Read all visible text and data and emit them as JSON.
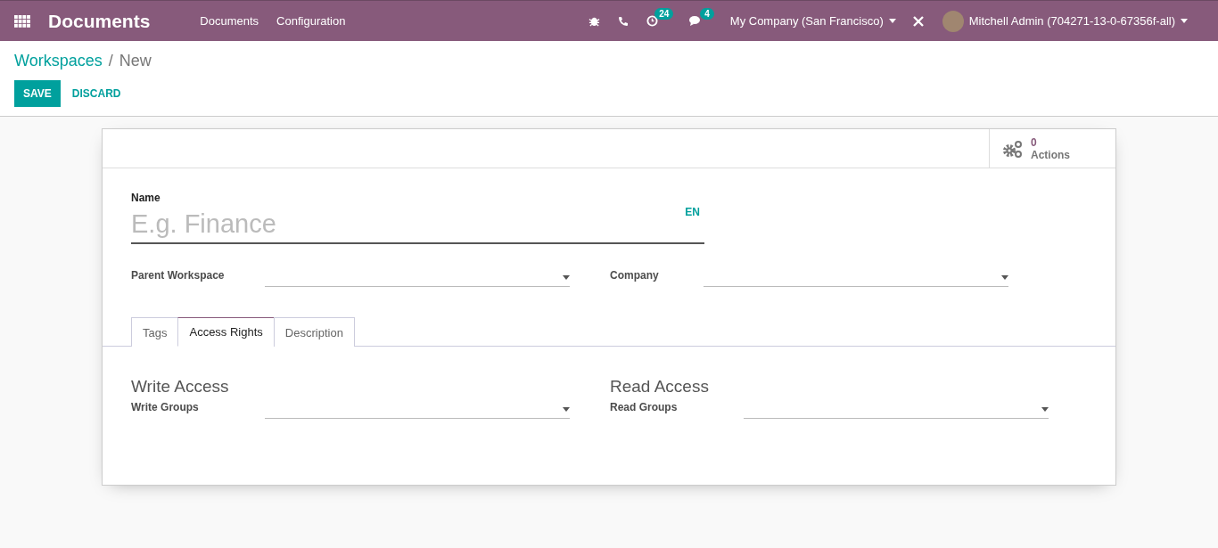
{
  "navbar": {
    "app_title": "Documents",
    "menus": [
      "Documents",
      "Configuration"
    ],
    "activity_count": "24",
    "messages_count": "4",
    "company": "My Company (San Francisco)",
    "user": "Mitchell Admin (704271-13-0-67356f-all)"
  },
  "breadcrumb": [
    "Workspaces",
    "New"
  ],
  "breadcrumb_separator": "/",
  "buttons": {
    "save": "SAVE",
    "discard": "DISCARD"
  },
  "button_box": {
    "count": "0",
    "label": "Actions"
  },
  "name_field": {
    "label": "Name",
    "placeholder": "E.g. Finance",
    "lang": "EN"
  },
  "fields": [
    {
      "label": "Parent Workspace"
    },
    {
      "label": "Company"
    }
  ],
  "tabs": [
    {
      "label": "Tags",
      "selected": false
    },
    {
      "label": "Access Rights",
      "selected": true
    },
    {
      "label": "Description",
      "selected": false
    }
  ],
  "access_groups": [
    {
      "title": "Write Access",
      "field": "Write Groups"
    },
    {
      "title": "Read Access",
      "field": "Read Groups"
    }
  ]
}
